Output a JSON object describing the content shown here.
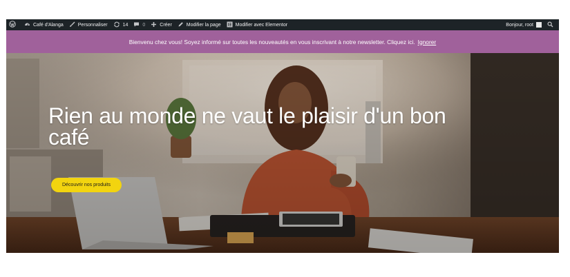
{
  "admin_bar": {
    "site_name": "Café d'Alanga",
    "customize": "Personnaliser",
    "updates_count": "14",
    "comments_count": "0",
    "new": "Créer",
    "edit_page": "Modifier la page",
    "edit_elementor": "Modifier avec Elementor",
    "greeting": "Bonjour, root"
  },
  "notice": {
    "message": "Bienvenu chez vous! Soyez informé sur toutes les nouveautés en vous inscrivant à notre newsletter. Cliquez ici.",
    "dismiss": "Ignorer",
    "background": "#a0619b"
  },
  "hero": {
    "title": "Rien au monde ne vaut le plaisir d'un bon café",
    "button": "Découvrir nos produits",
    "button_color": "#f2d40f"
  },
  "icons": [
    "wordpress-icon",
    "dashboard-icon",
    "brush-icon",
    "refresh-icon",
    "comment-icon",
    "plus-icon",
    "pencil-icon",
    "elementor-icon",
    "search-icon"
  ]
}
